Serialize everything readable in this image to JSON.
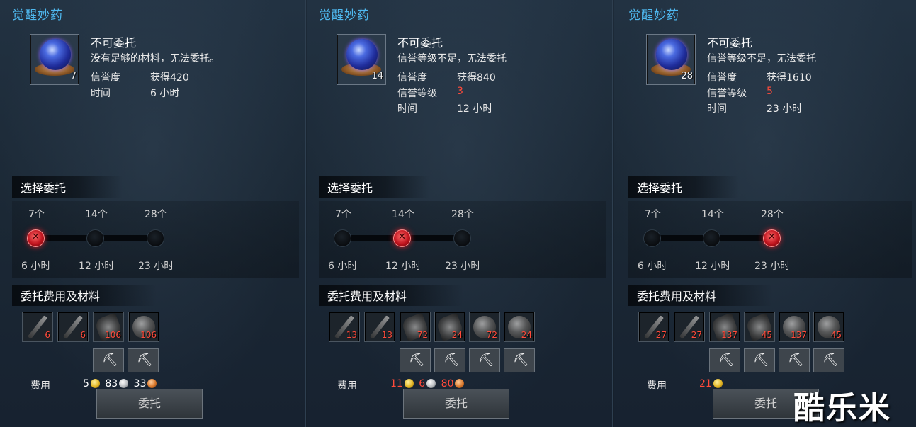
{
  "panels": [
    {
      "title": "觉醒妙药",
      "item_count": "7",
      "status": "不可委托",
      "reason": "没有足够的材料，无法委托。",
      "rows": [
        {
          "label": "信誉度",
          "value": "获得420",
          "highlight": false
        },
        {
          "label": "时间",
          "value": "6 小时",
          "highlight": false
        }
      ],
      "select_title": "选择委托",
      "options": [
        {
          "qty": "7个",
          "time": "6 小时",
          "selected": true
        },
        {
          "qty": "14个",
          "time": "12 小时",
          "selected": false
        },
        {
          "qty": "28个",
          "time": "23 小时",
          "selected": false
        }
      ],
      "materials_title": "委托费用及材料",
      "materials": [
        {
          "icon": "stick-icon",
          "count": "6"
        },
        {
          "icon": "stick-icon",
          "count": "6"
        },
        {
          "icon": "wing-icon",
          "count": "106"
        },
        {
          "icon": "orb-icon",
          "count": "106"
        }
      ],
      "tools": 2,
      "cost_label": "费用",
      "costs": [
        {
          "amount": "5",
          "coin": "gold",
          "red": false
        },
        {
          "amount": "83",
          "coin": "silver",
          "red": false
        },
        {
          "amount": "33",
          "coin": "copper",
          "red": false
        }
      ],
      "button": "委托"
    },
    {
      "title": "觉醒妙药",
      "item_count": "14",
      "status": "不可委托",
      "reason": "信誉等级不足，无法委托",
      "rows": [
        {
          "label": "信誉度",
          "value": "获得840",
          "highlight": false
        },
        {
          "label": "信誉等级",
          "value": "3",
          "highlight": true
        },
        {
          "label": "时间",
          "value": "12 小时",
          "highlight": false
        }
      ],
      "select_title": "选择委托",
      "options": [
        {
          "qty": "7个",
          "time": "6 小时",
          "selected": false
        },
        {
          "qty": "14个",
          "time": "12 小时",
          "selected": true
        },
        {
          "qty": "28个",
          "time": "23 小时",
          "selected": false
        }
      ],
      "materials_title": "委托费用及材料",
      "materials": [
        {
          "icon": "stick-icon",
          "count": "13"
        },
        {
          "icon": "stick-icon",
          "count": "13"
        },
        {
          "icon": "wing-icon",
          "count": "72"
        },
        {
          "icon": "wing-icon",
          "count": "24"
        },
        {
          "icon": "orb-icon",
          "count": "72"
        },
        {
          "icon": "orb-icon",
          "count": "24"
        }
      ],
      "tools": 4,
      "cost_label": "费用",
      "costs": [
        {
          "amount": "11",
          "coin": "gold",
          "red": true
        },
        {
          "amount": "6",
          "coin": "silver",
          "red": true
        },
        {
          "amount": "80",
          "coin": "copper",
          "red": true
        }
      ],
      "button": "委托"
    },
    {
      "title": "觉醒妙药",
      "item_count": "28",
      "status": "不可委托",
      "reason": "信誉等级不足，无法委托",
      "rows": [
        {
          "label": "信誉度",
          "value": "获得1610",
          "highlight": false
        },
        {
          "label": "信誉等级",
          "value": "5",
          "highlight": true
        },
        {
          "label": "时间",
          "value": "23 小时",
          "highlight": false
        }
      ],
      "select_title": "选择委托",
      "options": [
        {
          "qty": "7个",
          "time": "6 小时",
          "selected": false
        },
        {
          "qty": "14个",
          "time": "12 小时",
          "selected": false
        },
        {
          "qty": "28个",
          "time": "23 小时",
          "selected": true
        }
      ],
      "materials_title": "委托费用及材料",
      "materials": [
        {
          "icon": "stick-icon",
          "count": "27"
        },
        {
          "icon": "stick-icon",
          "count": "27"
        },
        {
          "icon": "wing-icon",
          "count": "137"
        },
        {
          "icon": "wing-icon",
          "count": "45"
        },
        {
          "icon": "orb-icon",
          "count": "137"
        },
        {
          "icon": "orb-icon",
          "count": "45"
        }
      ],
      "tools": 4,
      "cost_label": "费用",
      "costs": [
        {
          "amount": "21",
          "coin": "gold",
          "red": true
        }
      ],
      "button": "委托"
    }
  ],
  "watermark": "酷乐米"
}
